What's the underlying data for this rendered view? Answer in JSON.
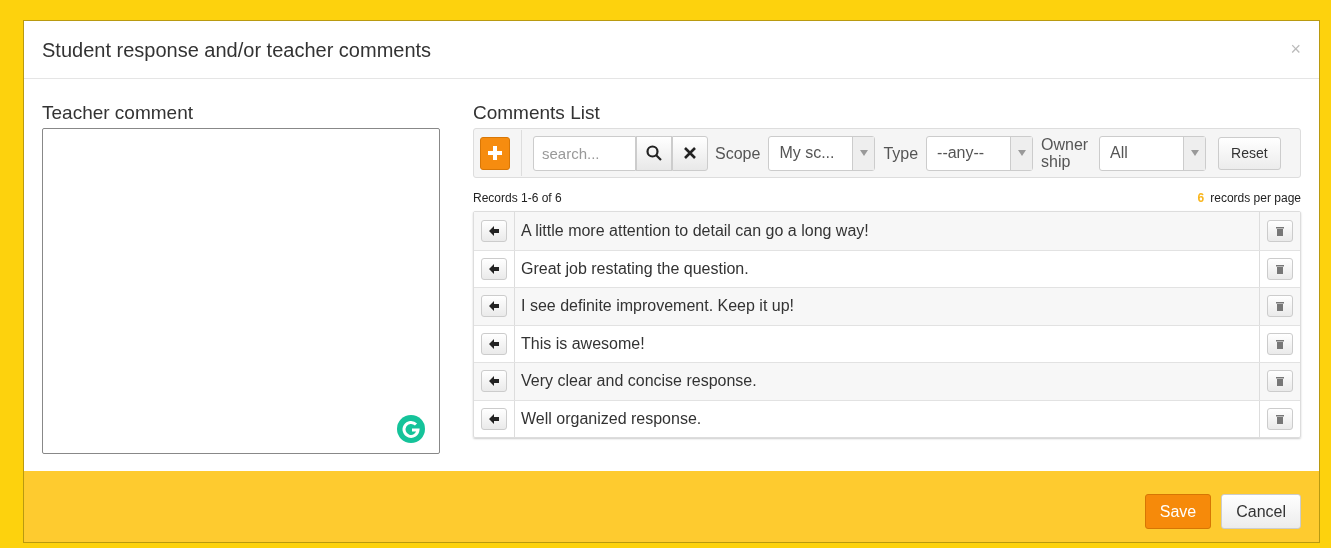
{
  "dialog": {
    "title": "Student response and/or teacher comments",
    "close": "×"
  },
  "teacher_comment": {
    "label": "Teacher comment"
  },
  "comments_list": {
    "title": "Comments List",
    "toolbar": {
      "search": {
        "placeholder": "search..."
      },
      "filters": [
        {
          "label": "Scope",
          "value": "My sc..."
        },
        {
          "label": "Type",
          "value": "--any--"
        },
        {
          "label": "Owner ship",
          "value": "All"
        }
      ],
      "reset": "Reset"
    },
    "records_info": "Records 1-6 of 6",
    "per_page_count": "6",
    "per_page_label": "records per page",
    "rows": [
      {
        "text": "A little more attention to detail can go a long way!"
      },
      {
        "text": "Great job restating the question."
      },
      {
        "text": "I see definite improvement. Keep it up!"
      },
      {
        "text": "This is awesome!"
      },
      {
        "text": "Very clear and concise response."
      },
      {
        "text": "Well organized response."
      }
    ]
  },
  "footer": {
    "buttons": [
      {
        "label": "Save",
        "kind": "primary"
      },
      {
        "label": "Cancel",
        "kind": "secondary"
      }
    ]
  }
}
